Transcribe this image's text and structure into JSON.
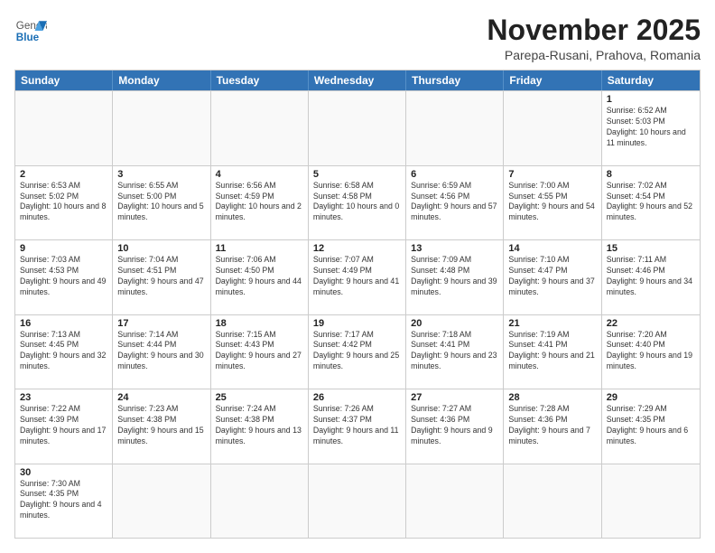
{
  "header": {
    "logo_general": "General",
    "logo_blue": "Blue",
    "month_year": "November 2025",
    "location": "Parepa-Rusani, Prahova, Romania"
  },
  "weekdays": [
    "Sunday",
    "Monday",
    "Tuesday",
    "Wednesday",
    "Thursday",
    "Friday",
    "Saturday"
  ],
  "rows": [
    [
      {
        "day": "",
        "info": ""
      },
      {
        "day": "",
        "info": ""
      },
      {
        "day": "",
        "info": ""
      },
      {
        "day": "",
        "info": ""
      },
      {
        "day": "",
        "info": ""
      },
      {
        "day": "",
        "info": ""
      },
      {
        "day": "1",
        "info": "Sunrise: 6:52 AM\nSunset: 5:03 PM\nDaylight: 10 hours and 11 minutes."
      }
    ],
    [
      {
        "day": "2",
        "info": "Sunrise: 6:53 AM\nSunset: 5:02 PM\nDaylight: 10 hours and 8 minutes."
      },
      {
        "day": "3",
        "info": "Sunrise: 6:55 AM\nSunset: 5:00 PM\nDaylight: 10 hours and 5 minutes."
      },
      {
        "day": "4",
        "info": "Sunrise: 6:56 AM\nSunset: 4:59 PM\nDaylight: 10 hours and 2 minutes."
      },
      {
        "day": "5",
        "info": "Sunrise: 6:58 AM\nSunset: 4:58 PM\nDaylight: 10 hours and 0 minutes."
      },
      {
        "day": "6",
        "info": "Sunrise: 6:59 AM\nSunset: 4:56 PM\nDaylight: 9 hours and 57 minutes."
      },
      {
        "day": "7",
        "info": "Sunrise: 7:00 AM\nSunset: 4:55 PM\nDaylight: 9 hours and 54 minutes."
      },
      {
        "day": "8",
        "info": "Sunrise: 7:02 AM\nSunset: 4:54 PM\nDaylight: 9 hours and 52 minutes."
      }
    ],
    [
      {
        "day": "9",
        "info": "Sunrise: 7:03 AM\nSunset: 4:53 PM\nDaylight: 9 hours and 49 minutes."
      },
      {
        "day": "10",
        "info": "Sunrise: 7:04 AM\nSunset: 4:51 PM\nDaylight: 9 hours and 47 minutes."
      },
      {
        "day": "11",
        "info": "Sunrise: 7:06 AM\nSunset: 4:50 PM\nDaylight: 9 hours and 44 minutes."
      },
      {
        "day": "12",
        "info": "Sunrise: 7:07 AM\nSunset: 4:49 PM\nDaylight: 9 hours and 41 minutes."
      },
      {
        "day": "13",
        "info": "Sunrise: 7:09 AM\nSunset: 4:48 PM\nDaylight: 9 hours and 39 minutes."
      },
      {
        "day": "14",
        "info": "Sunrise: 7:10 AM\nSunset: 4:47 PM\nDaylight: 9 hours and 37 minutes."
      },
      {
        "day": "15",
        "info": "Sunrise: 7:11 AM\nSunset: 4:46 PM\nDaylight: 9 hours and 34 minutes."
      }
    ],
    [
      {
        "day": "16",
        "info": "Sunrise: 7:13 AM\nSunset: 4:45 PM\nDaylight: 9 hours and 32 minutes."
      },
      {
        "day": "17",
        "info": "Sunrise: 7:14 AM\nSunset: 4:44 PM\nDaylight: 9 hours and 30 minutes."
      },
      {
        "day": "18",
        "info": "Sunrise: 7:15 AM\nSunset: 4:43 PM\nDaylight: 9 hours and 27 minutes."
      },
      {
        "day": "19",
        "info": "Sunrise: 7:17 AM\nSunset: 4:42 PM\nDaylight: 9 hours and 25 minutes."
      },
      {
        "day": "20",
        "info": "Sunrise: 7:18 AM\nSunset: 4:41 PM\nDaylight: 9 hours and 23 minutes."
      },
      {
        "day": "21",
        "info": "Sunrise: 7:19 AM\nSunset: 4:41 PM\nDaylight: 9 hours and 21 minutes."
      },
      {
        "day": "22",
        "info": "Sunrise: 7:20 AM\nSunset: 4:40 PM\nDaylight: 9 hours and 19 minutes."
      }
    ],
    [
      {
        "day": "23",
        "info": "Sunrise: 7:22 AM\nSunset: 4:39 PM\nDaylight: 9 hours and 17 minutes."
      },
      {
        "day": "24",
        "info": "Sunrise: 7:23 AM\nSunset: 4:38 PM\nDaylight: 9 hours and 15 minutes."
      },
      {
        "day": "25",
        "info": "Sunrise: 7:24 AM\nSunset: 4:38 PM\nDaylight: 9 hours and 13 minutes."
      },
      {
        "day": "26",
        "info": "Sunrise: 7:26 AM\nSunset: 4:37 PM\nDaylight: 9 hours and 11 minutes."
      },
      {
        "day": "27",
        "info": "Sunrise: 7:27 AM\nSunset: 4:36 PM\nDaylight: 9 hours and 9 minutes."
      },
      {
        "day": "28",
        "info": "Sunrise: 7:28 AM\nSunset: 4:36 PM\nDaylight: 9 hours and 7 minutes."
      },
      {
        "day": "29",
        "info": "Sunrise: 7:29 AM\nSunset: 4:35 PM\nDaylight: 9 hours and 6 minutes."
      }
    ],
    [
      {
        "day": "30",
        "info": "Sunrise: 7:30 AM\nSunset: 4:35 PM\nDaylight: 9 hours and 4 minutes."
      },
      {
        "day": "",
        "info": ""
      },
      {
        "day": "",
        "info": ""
      },
      {
        "day": "",
        "info": ""
      },
      {
        "day": "",
        "info": ""
      },
      {
        "day": "",
        "info": ""
      },
      {
        "day": "",
        "info": ""
      }
    ]
  ]
}
